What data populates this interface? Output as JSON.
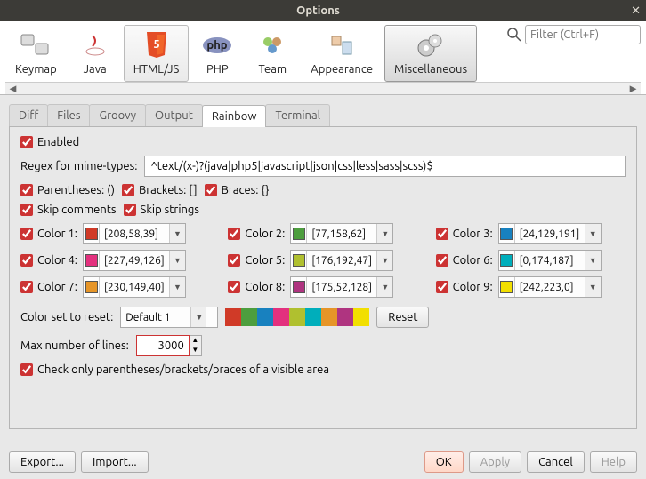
{
  "window": {
    "title": "Options"
  },
  "toolbar": {
    "items": [
      {
        "id": "keymap",
        "label": "Keymap"
      },
      {
        "id": "java",
        "label": "Java"
      },
      {
        "id": "htmljs",
        "label": "HTML/JS"
      },
      {
        "id": "php",
        "label": "PHP"
      },
      {
        "id": "team",
        "label": "Team"
      },
      {
        "id": "appearance",
        "label": "Appearance"
      },
      {
        "id": "misc",
        "label": "Miscellaneous"
      }
    ],
    "search_placeholder": "Filter (Ctrl+F)"
  },
  "tabs": {
    "items": [
      "Diff",
      "Files",
      "Groovy",
      "Output",
      "Rainbow",
      "Terminal"
    ],
    "active": "Rainbow"
  },
  "rainbow": {
    "enabled_label": "Enabled",
    "regex_label": "Regex for mime-types:",
    "regex_value": "^text/(x-)?(java|php5|javascript|json|css|less|sass|scss)$",
    "parentheses_label": "Parentheses: ()",
    "brackets_label": "Brackets: []",
    "braces_label": "Braces: {}",
    "skip_comments": "Skip comments",
    "skip_strings": "Skip strings",
    "colors": [
      {
        "label": "Color 1:",
        "value": "[208,58,39]",
        "hex": "#d03a27"
      },
      {
        "label": "Color 2:",
        "value": "[77,158,62]",
        "hex": "#4d9e3e"
      },
      {
        "label": "Color 3:",
        "value": "[24,129,191]",
        "hex": "#1881bf"
      },
      {
        "label": "Color 4:",
        "value": "[227,49,126]",
        "hex": "#e3317e"
      },
      {
        "label": "Color 5:",
        "value": "[176,192,47]",
        "hex": "#b0c02f"
      },
      {
        "label": "Color 6:",
        "value": "[0,174,187]",
        "hex": "#00aebb"
      },
      {
        "label": "Color 7:",
        "value": "[230,149,40]",
        "hex": "#e69528"
      },
      {
        "label": "Color 8:",
        "value": "[175,52,128]",
        "hex": "#af3480"
      },
      {
        "label": "Color 9:",
        "value": "[242,223,0]",
        "hex": "#f2df00"
      }
    ],
    "colorset_label": "Color set to reset:",
    "colorset_value": "Default 1",
    "palette": [
      "#d03a27",
      "#4d9e3e",
      "#1881bf",
      "#e3317e",
      "#b0c02f",
      "#00aebb",
      "#e69528",
      "#af3480",
      "#f2df00"
    ],
    "reset_label": "Reset",
    "maxlines_label": "Max number of lines:",
    "maxlines_value": "3000",
    "visible_area_label": "Check only parentheses/brackets/braces of a visible area"
  },
  "footer": {
    "export": "Export...",
    "import": "Import...",
    "ok": "OK",
    "apply": "Apply",
    "cancel": "Cancel",
    "help": "Help"
  }
}
